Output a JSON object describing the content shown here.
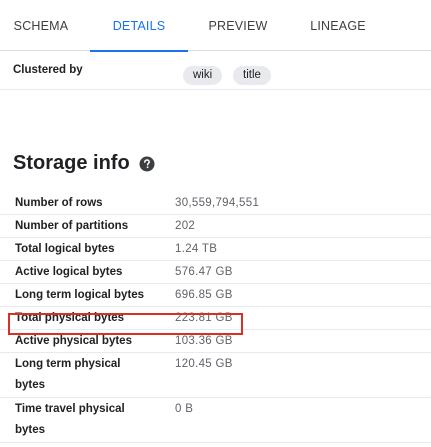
{
  "tabs": [
    {
      "label": "SCHEMA",
      "active": false
    },
    {
      "label": "DETAILS",
      "active": true
    },
    {
      "label": "PREVIEW",
      "active": false
    },
    {
      "label": "LINEAGE",
      "active": false
    }
  ],
  "clustered": {
    "label": "Clustered by",
    "chips": [
      "wiki",
      "title"
    ]
  },
  "storage": {
    "title": "Storage info",
    "help_icon": "help-circle-icon",
    "rows": [
      {
        "label": "Number of rows",
        "value": "30,559,794,551"
      },
      {
        "label": "Number of partitions",
        "value": "202"
      },
      {
        "label": "Total logical bytes",
        "value": "1.24 TB"
      },
      {
        "label": "Active logical bytes",
        "value": "576.47 GB"
      },
      {
        "label": "Long term logical bytes",
        "value": "696.85 GB"
      },
      {
        "label": "Total physical bytes",
        "value": "223.81 GB"
      },
      {
        "label": "Active physical bytes",
        "value": "103.36 GB"
      },
      {
        "label": "Long term physical bytes",
        "value": "120.45 GB"
      },
      {
        "label": "Time travel physical bytes",
        "value": "0 B"
      }
    ]
  },
  "colors": {
    "accent": "#1a73e8",
    "highlight_border": "#d93025",
    "chip_bg": "#e8eaed"
  }
}
